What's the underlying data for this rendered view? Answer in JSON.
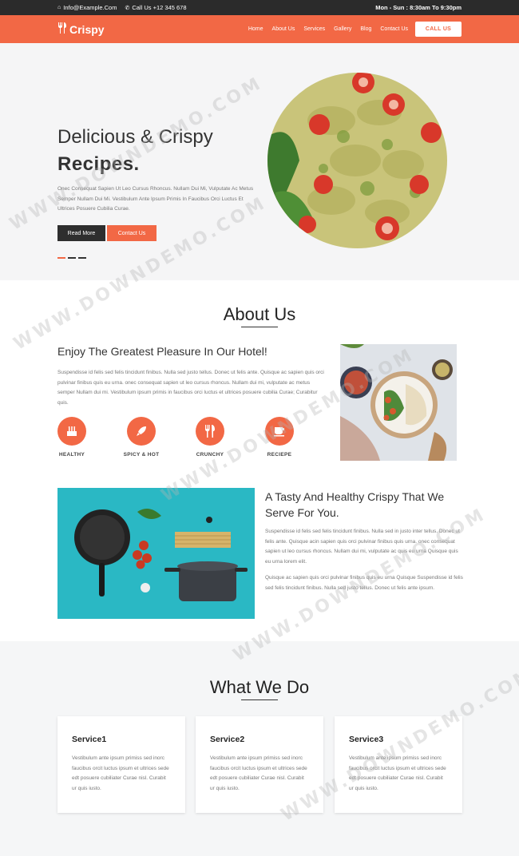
{
  "topbar": {
    "email": "Info@Example.Com",
    "phone": "Call Us +12 345 678",
    "hours": "Mon - Sun : 8:30am To 9:30pm"
  },
  "nav": {
    "logo": "Crispy",
    "items": [
      "Home",
      "About Us",
      "Services",
      "Gallery",
      "Blog",
      "Contact Us"
    ],
    "call_button": "CALL US"
  },
  "hero": {
    "title_line1": "Delicious & Crispy",
    "title_line2": "Recipes.",
    "text": "Onec Consequat Sapien Ut Leo Cursus Rhoncus. Nullam Dui Mi, Vulputate Ac Metus Semper Nullam Dui Mi. Vestibulum Ante Ipsum Primis In Faucibus Orci Luctus Et Ultrices Posuere Cubilia Curae.",
    "btn_primary": "Read More",
    "btn_secondary": "Contact Us"
  },
  "about": {
    "title": "About Us",
    "heading": "Enjoy The Greatest Pleasure In Our Hotel!",
    "text": "Suspendisse id felis sed felis tincidunt finibus. Nulla sed justo tellus. Donec ut felis ante. Quisque ac sapien quis orci pulvinar finibus quis eu urna. onec consequat sapien ut leo cursus rhoncus. Nullam dui mi, vulputate ac metus semper Nullam dui mi. Vestibulum ipsum primis in faucibus orci luctus et ultrices posuere cubilia Curae; Curabitur quis.",
    "features": [
      "HEALTHY",
      "SPICY & HOT",
      "CRUNCHY",
      "RECIEPE"
    ]
  },
  "tasty": {
    "heading": "A Tasty And Healthy Crispy That We Serve For You.",
    "para1": "Suspendisse id felis sed felis tincidunt finibus. Nulla sed in justo inter tellus. Donec ut felis ante. Quisque acin sapien quis orci pulvinar finibus quis urna. onec consequat sapien ut leo cursus rhoncus. Nullam dui mi, vulputate ac quis eu urna Quisque quis eu urna lorem elit.",
    "para2": "Quisque ac sapien quis orci pulvinar finibus quis eu urna Quisque Suspendisse id felis sed felis tincidunt finibus. Nulla sed justo tellus. Donec ut felis ante ipsum."
  },
  "services": {
    "title": "What We Do",
    "cards": [
      {
        "title": "Service1",
        "text": "Vestibulum ante ipsum primiss sed inorc faucibus orcit luctus ipsum et ultrices sede edt posuere cubiliater Curae nisl. Curabit ur quis iusto."
      },
      {
        "title": "Service2",
        "text": "Vestibulum ante ipsum primiss sed inorc faucibus orcit luctus ipsum et ultrices sede edt posuere cubiliater Curae nisl. Curabit ur quis iusto."
      },
      {
        "title": "Service3",
        "text": "Vestibulum ante ipsum primiss sed inorc faucibus orcit luctus ipsum et ultrices sede edt posuere cubiliater Curae nisl. Curabit ur quis iusto."
      }
    ]
  },
  "watermark": "WWW.DOWNDEMO.COM",
  "colors": {
    "accent": "#f26845",
    "dark": "#2b2b2b",
    "teal": "#2ab8c4"
  }
}
